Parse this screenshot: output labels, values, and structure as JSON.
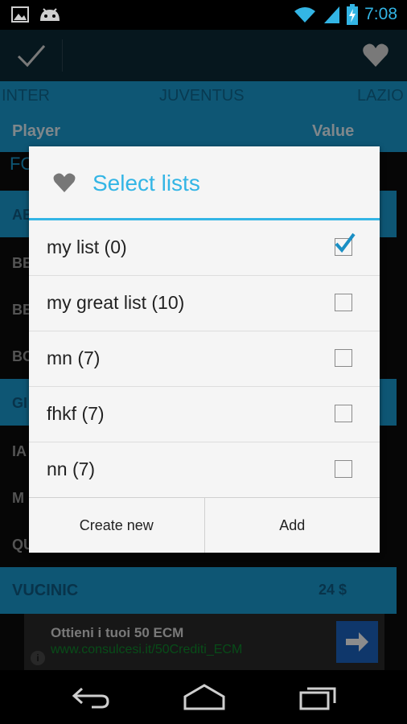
{
  "status_bar": {
    "time": "7:08",
    "icons": [
      "image-icon",
      "android-icon",
      "wifi-icon",
      "battery-charging-icon",
      "signal-icon"
    ]
  },
  "action_bar": {
    "icons": [
      "checkmark-icon",
      "heart-icon"
    ]
  },
  "tabs": [
    {
      "label": "INTER"
    },
    {
      "label": "JUVENTUS"
    },
    {
      "label": "LAZIO"
    }
  ],
  "columns": {
    "player": "Player",
    "value": "Value"
  },
  "background_list": {
    "partial_header": "FO",
    "rows": [
      "BE",
      "BE",
      "BO",
      "IA",
      "M",
      "QU"
    ],
    "sections": [
      "AB",
      "GI"
    ],
    "last_row": {
      "name": "VUCINIC",
      "value": "24 $"
    }
  },
  "ad": {
    "title": "Ottieni i tuoi 50 ECM",
    "url": "www.consulcesi.it/50Crediti_ECM",
    "info": "i"
  },
  "dialog": {
    "title": "Select lists",
    "items": [
      {
        "label": "my list (0)",
        "checked": true
      },
      {
        "label": "my great list (10)",
        "checked": false
      },
      {
        "label": "mn (7)",
        "checked": false
      },
      {
        "label": "fhkf (7)",
        "checked": false
      },
      {
        "label": "nn (7)",
        "checked": false
      }
    ],
    "buttons": {
      "create_new": "Create new",
      "add": "Add"
    }
  },
  "colors": {
    "accent": "#33b5e5",
    "tab_bg": "#1b9dd3",
    "action_bar": "#0c2a37"
  }
}
